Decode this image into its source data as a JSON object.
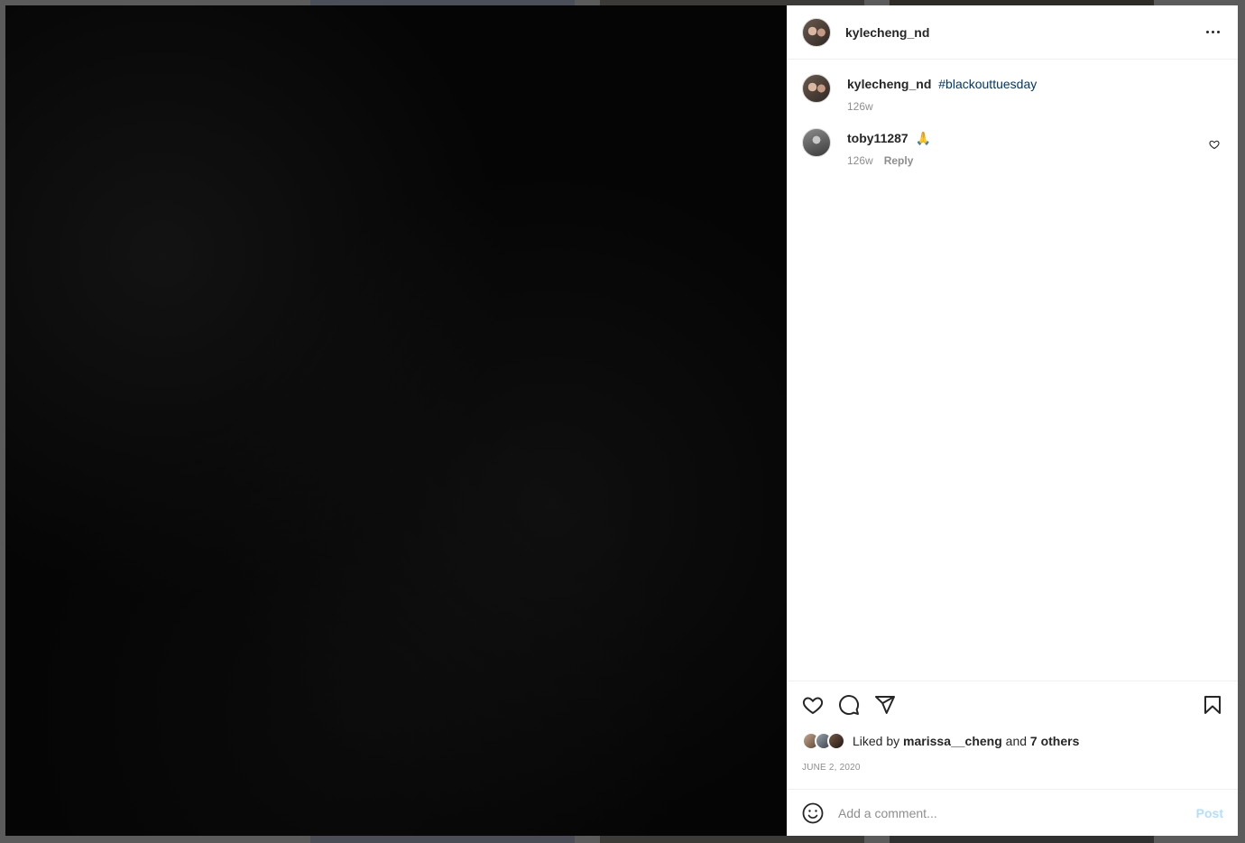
{
  "header": {
    "username": "kylecheng_nd"
  },
  "caption": {
    "username": "kylecheng_nd",
    "hashtag": "#blackouttuesday",
    "age": "126w"
  },
  "comments": [
    {
      "username": "toby11287",
      "text": "🙏",
      "age": "126w",
      "reply_label": "Reply"
    }
  ],
  "likes": {
    "prefix": "Liked by",
    "liker": "marissa__cheng",
    "connector": "and",
    "others": "7 others"
  },
  "date": "June 2, 2020",
  "comment_box": {
    "placeholder": "Add a comment...",
    "post_label": "Post"
  },
  "colors": {
    "hashtag": "#00376b",
    "post_disabled": "#b2dffc",
    "muted": "#8e8e8e"
  },
  "icons": [
    "more-icon",
    "heart-icon",
    "comment-icon",
    "share-icon",
    "bookmark-icon",
    "emoji-icon",
    "small-heart-icon"
  ]
}
